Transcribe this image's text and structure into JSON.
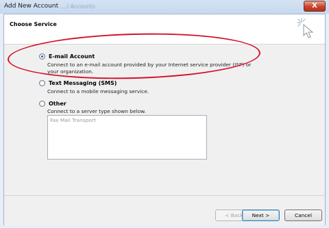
{
  "window": {
    "title": "Add New Account",
    "blurred_title_text": "...,.l Accounts",
    "close_label": "X"
  },
  "header": {
    "title": "Choose Service"
  },
  "options": [
    {
      "label": "E-mail Account",
      "description": "Connect to an e-mail account provided by your Internet service provider (ISP) or your organization.",
      "selected": true
    },
    {
      "label": "Text Messaging (SMS)",
      "description": "Connect to a mobile messaging service.",
      "selected": false
    },
    {
      "label": "Other",
      "description": "Connect to a server type shown below.",
      "selected": false
    }
  ],
  "other_list": {
    "items": [
      "Fax Mail Transport"
    ]
  },
  "footer": {
    "back_label": "< Back",
    "next_label": "Next >",
    "cancel_label": "Cancel"
  },
  "colors": {
    "annotation": "#d3112a",
    "titlebar": "#c6d9ef",
    "close_button": "#c7442b"
  }
}
